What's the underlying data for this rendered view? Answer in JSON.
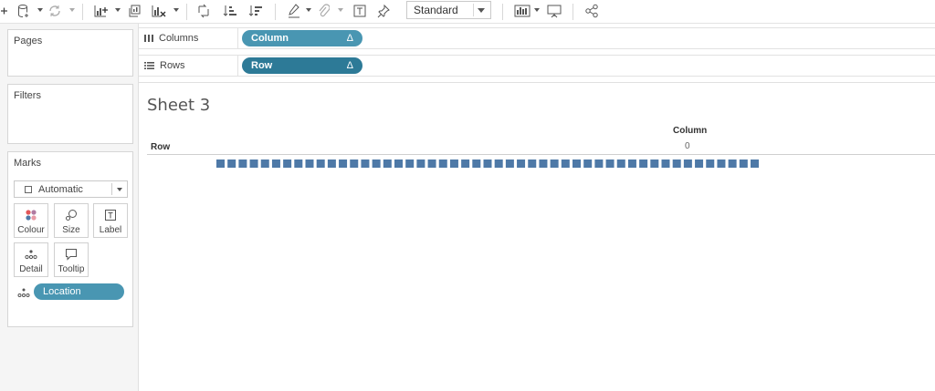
{
  "toolbar": {
    "mark_type_select": "Standard"
  },
  "pages_card": {
    "title": "Pages"
  },
  "filters_card": {
    "title": "Filters"
  },
  "marks_card": {
    "title": "Marks",
    "mark_type": "Automatic",
    "buttons": [
      {
        "label": "Colour",
        "icon": "colour-icon"
      },
      {
        "label": "Size",
        "icon": "size-icon"
      },
      {
        "label": "Label",
        "icon": "label-icon"
      },
      {
        "label": "Detail",
        "icon": "detail-icon"
      },
      {
        "label": "Tooltip",
        "icon": "tooltip-icon"
      }
    ],
    "detail_field": "Location"
  },
  "shelves": {
    "columns": {
      "label": "Columns",
      "pill": "Column",
      "pill_suffix": "Δ"
    },
    "rows": {
      "label": "Rows",
      "pill": "Row",
      "pill_suffix": "Δ"
    }
  },
  "sheet": {
    "title": "Sheet 3",
    "column_header": "Column",
    "column_tick": "0",
    "row_header": "Row"
  },
  "chart_data": {
    "type": "scatter",
    "mark_shape": "square",
    "mark_color": "#4e79a7",
    "mark_count": 49,
    "column_value": 0,
    "xlabel": "Column",
    "ylabel": "Row"
  },
  "colors": {
    "pill_dimension": "#4996b2",
    "pill_rows": "#2d7a97",
    "mark": "#4e79a7"
  }
}
